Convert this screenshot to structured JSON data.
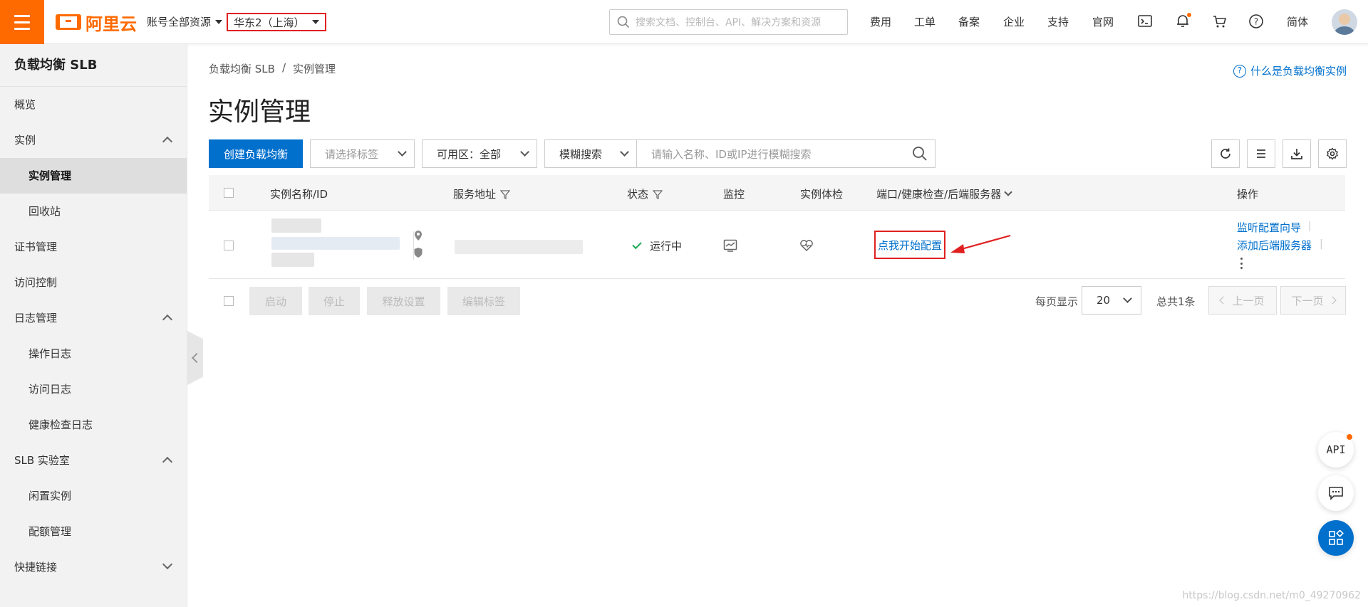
{
  "topbar": {
    "logo_text": "阿里云",
    "account": "账号全部资源",
    "region": "华东2（上海）",
    "search_placeholder": "搜索文档、控制台、API、解决方案和资源",
    "nav": [
      "费用",
      "工单",
      "备案",
      "企业",
      "支持",
      "官网"
    ],
    "lang": "简体",
    "icons": [
      "terminal-icon",
      "bell-icon",
      "cart-icon",
      "help-icon"
    ]
  },
  "sidebar": {
    "title": "负载均衡 SLB",
    "items": [
      {
        "label": "概览"
      },
      {
        "label": "实例"
      },
      {
        "label": "实例管理"
      },
      {
        "label": "回收站"
      },
      {
        "label": "证书管理"
      },
      {
        "label": "访问控制"
      },
      {
        "label": "日志管理"
      },
      {
        "label": "操作日志"
      },
      {
        "label": "访问日志"
      },
      {
        "label": "健康检查日志"
      },
      {
        "label": "SLB 实验室"
      },
      {
        "label": "闲置实例"
      },
      {
        "label": "配额管理"
      },
      {
        "label": "快捷链接"
      }
    ]
  },
  "main": {
    "breadcrumb_root": "负载均衡 SLB",
    "breadcrumb_sep": "/",
    "breadcrumb_current": "实例管理",
    "help_link": "什么是负载均衡实例",
    "title": "实例管理",
    "create_button": "创建负载均衡",
    "tag_select_placeholder": "请选择标签",
    "zone_select": "可用区：全部",
    "search_mode": "模糊搜索",
    "search_placeholder": "请输入名称、ID或IP进行模糊搜索"
  },
  "table": {
    "headers": {
      "name": "实例名称/ID",
      "address": "服务地址",
      "status": "状态",
      "monitor": "监控",
      "health": "实例体检",
      "ports": "端口/健康检查/后端服务器",
      "actions": "操作"
    },
    "row": {
      "status": "运行中",
      "config_link": "点我开始配置",
      "action_1": "监听配置向导",
      "action_2": "添加后端服务器"
    }
  },
  "footer": {
    "buttons": [
      "启动",
      "停止",
      "释放设置",
      "编辑标签"
    ],
    "page_size_label": "每页显示",
    "page_size": "20",
    "total": "总共1条",
    "prev": "上一页",
    "next": "下一页"
  },
  "floating": {
    "api_label": "API"
  },
  "watermark": "https://blog.csdn.net/m0_49270962",
  "colors": {
    "brand": "#ff6a00",
    "primary": "#0070cc",
    "highlight_border": "#e02020",
    "success": "#1aaa55"
  }
}
